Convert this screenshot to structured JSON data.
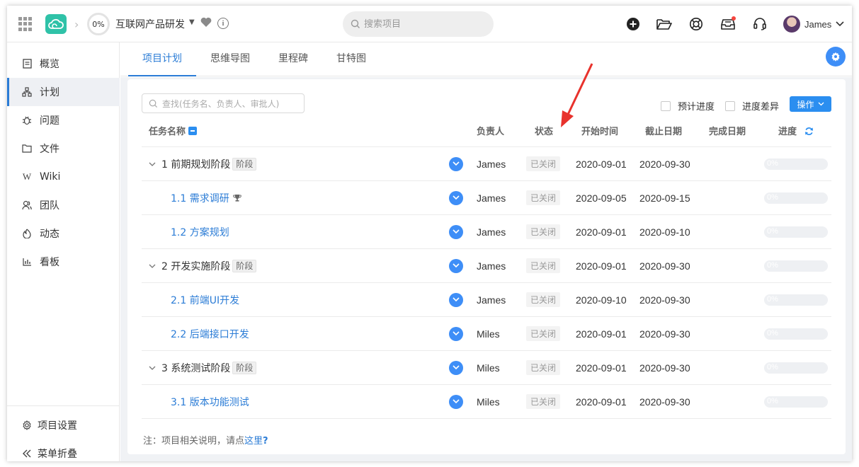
{
  "topbar": {
    "progress": "0%",
    "project_name": "互联网产品研发",
    "search_placeholder": "搜索项目",
    "user_name": "James"
  },
  "sidebar": {
    "items": [
      {
        "label": "概览",
        "icon": "overview-icon"
      },
      {
        "label": "计划",
        "icon": "plan-icon"
      },
      {
        "label": "问题",
        "icon": "bug-icon"
      },
      {
        "label": "文件",
        "icon": "folder-icon"
      },
      {
        "label": "Wiki",
        "icon": "wiki-icon"
      },
      {
        "label": "团队",
        "icon": "team-icon"
      },
      {
        "label": "动态",
        "icon": "activity-icon"
      },
      {
        "label": "看板",
        "icon": "chart-icon"
      }
    ],
    "bottom": [
      {
        "label": "项目设置",
        "icon": "gear-icon"
      },
      {
        "label": "菜单折叠",
        "icon": "double-chevron-left-icon"
      }
    ]
  },
  "tabs": [
    "项目计划",
    "思维导图",
    "里程碑",
    "甘特图"
  ],
  "toolbar": {
    "filter_placeholder": "查找(任务名、负责人、审批人)",
    "check_estimate": "预计进度",
    "check_variance": "进度差异",
    "operate": "操作"
  },
  "table": {
    "headers": {
      "name": "任务名称",
      "owner": "负责人",
      "status": "状态",
      "start": "开始时间",
      "due": "截止日期",
      "finish": "完成日期",
      "progress": "进度"
    },
    "rows": [
      {
        "name": "1 前期规划阶段",
        "tag": "阶段",
        "kind": "phase",
        "owner": "James",
        "status": "已关闭",
        "start": "2020-09-01",
        "due": "2020-09-30",
        "finish": "",
        "progress": "0%"
      },
      {
        "name": "1.1 需求调研",
        "tag": "",
        "kind": "task",
        "trophy": true,
        "owner": "James",
        "status": "已关闭",
        "start": "2020-09-05",
        "due": "2020-09-15",
        "finish": "",
        "progress": "0%"
      },
      {
        "name": "1.2 方案规划",
        "tag": "",
        "kind": "task",
        "owner": "James",
        "status": "已关闭",
        "start": "2020-09-01",
        "due": "2020-09-10",
        "finish": "",
        "progress": "0%"
      },
      {
        "name": "2 开发实施阶段",
        "tag": "阶段",
        "kind": "phase",
        "owner": "James",
        "status": "已关闭",
        "start": "2020-09-01",
        "due": "2020-09-30",
        "finish": "",
        "progress": "0%"
      },
      {
        "name": "2.1 前端UI开发",
        "tag": "",
        "kind": "task",
        "owner": "James",
        "status": "已关闭",
        "start": "2020-09-10",
        "due": "2020-09-30",
        "finish": "",
        "progress": "0%"
      },
      {
        "name": "2.2 后端接口开发",
        "tag": "",
        "kind": "task",
        "owner": "Miles",
        "status": "已关闭",
        "start": "2020-09-01",
        "due": "2020-09-30",
        "finish": "",
        "progress": "0%"
      },
      {
        "name": "3 系统测试阶段",
        "tag": "阶段",
        "kind": "phase",
        "owner": "Miles",
        "status": "已关闭",
        "start": "2020-09-01",
        "due": "2020-09-30",
        "finish": "",
        "progress": "0%"
      },
      {
        "name": "3.1 版本功能测试",
        "tag": "",
        "kind": "task",
        "owner": "Miles",
        "status": "已关闭",
        "start": "2020-09-01",
        "due": "2020-09-30",
        "finish": "",
        "progress": "0%"
      }
    ]
  },
  "note": {
    "prefix": "注：项目相关说明，请点",
    "link": "这里",
    "suffix": "?"
  },
  "colors": {
    "accent": "#2b7cd6",
    "button": "#2b8ef0",
    "logo": "#2fc2a8",
    "annotation_arrow": "#e8322c"
  }
}
